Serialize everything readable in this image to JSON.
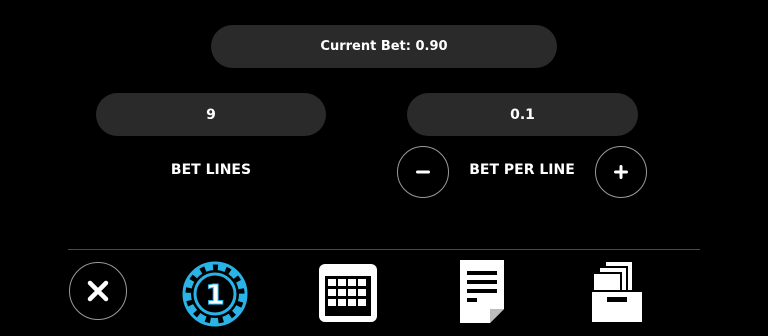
{
  "bet_panel": {
    "current_bet_label": "Current Bet: 0.90",
    "bet_lines": {
      "value": "9",
      "label": "BET LINES"
    },
    "bet_per_line": {
      "value": "0.1",
      "label": "BET PER LINE"
    }
  },
  "toolbar": {
    "items": [
      {
        "icon": "close-icon"
      },
      {
        "icon": "chip-icon",
        "chip_value": "1",
        "accent": "#2ab3e6"
      },
      {
        "icon": "calendar-icon"
      },
      {
        "icon": "paytable-icon"
      },
      {
        "icon": "archive-icon"
      }
    ]
  }
}
